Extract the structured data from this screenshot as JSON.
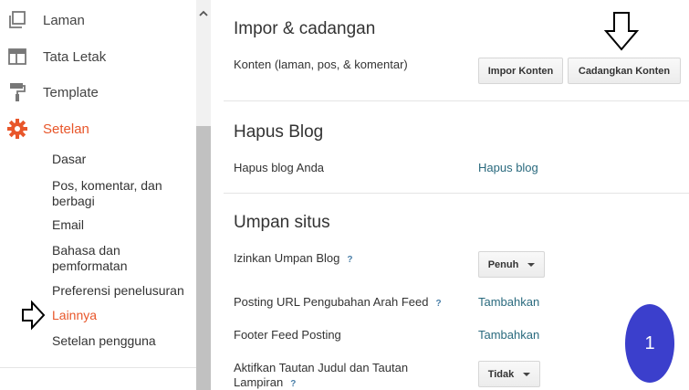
{
  "sidebar": {
    "items": [
      {
        "label": "Laman",
        "icon": "pages-icon"
      },
      {
        "label": "Tata Letak",
        "icon": "layout-icon"
      },
      {
        "label": "Template",
        "icon": "paint-roller-icon"
      },
      {
        "label": "Setelan",
        "icon": "gear-icon"
      }
    ],
    "subitems": [
      "Dasar",
      "Pos, komentar, dan\nberbagi",
      "Email",
      "Bahasa dan\npemformatan",
      "Preferensi penelusuran",
      "Lainnya",
      "Setelan pengguna"
    ]
  },
  "sections": {
    "import": {
      "title": "Impor & cadangan",
      "row_label": "Konten (laman, pos, & komentar)",
      "import_button": "Impor Konten",
      "backup_button": "Cadangkan Konten"
    },
    "delete": {
      "title": "Hapus Blog",
      "row_label": "Hapus blog Anda",
      "link": "Hapus blog"
    },
    "feed": {
      "title": "Umpan situs",
      "rows": [
        {
          "label": "Izinkan Umpan Blog",
          "help": "?",
          "value": "Penuh"
        },
        {
          "label": "Posting URL Pengubahan Arah Feed",
          "help": "?",
          "value": "Tambahkan"
        },
        {
          "label": "Footer Feed Posting",
          "value": "Tambahkan"
        },
        {
          "label": "Aktifkan Tautan Judul dan Tautan\nLampiran",
          "help": "?",
          "value": "Tidak"
        }
      ]
    }
  },
  "badge": "1",
  "colors": {
    "accent": "#e8562a",
    "link": "#2a6a7e",
    "badge": "#3b3fcc"
  }
}
